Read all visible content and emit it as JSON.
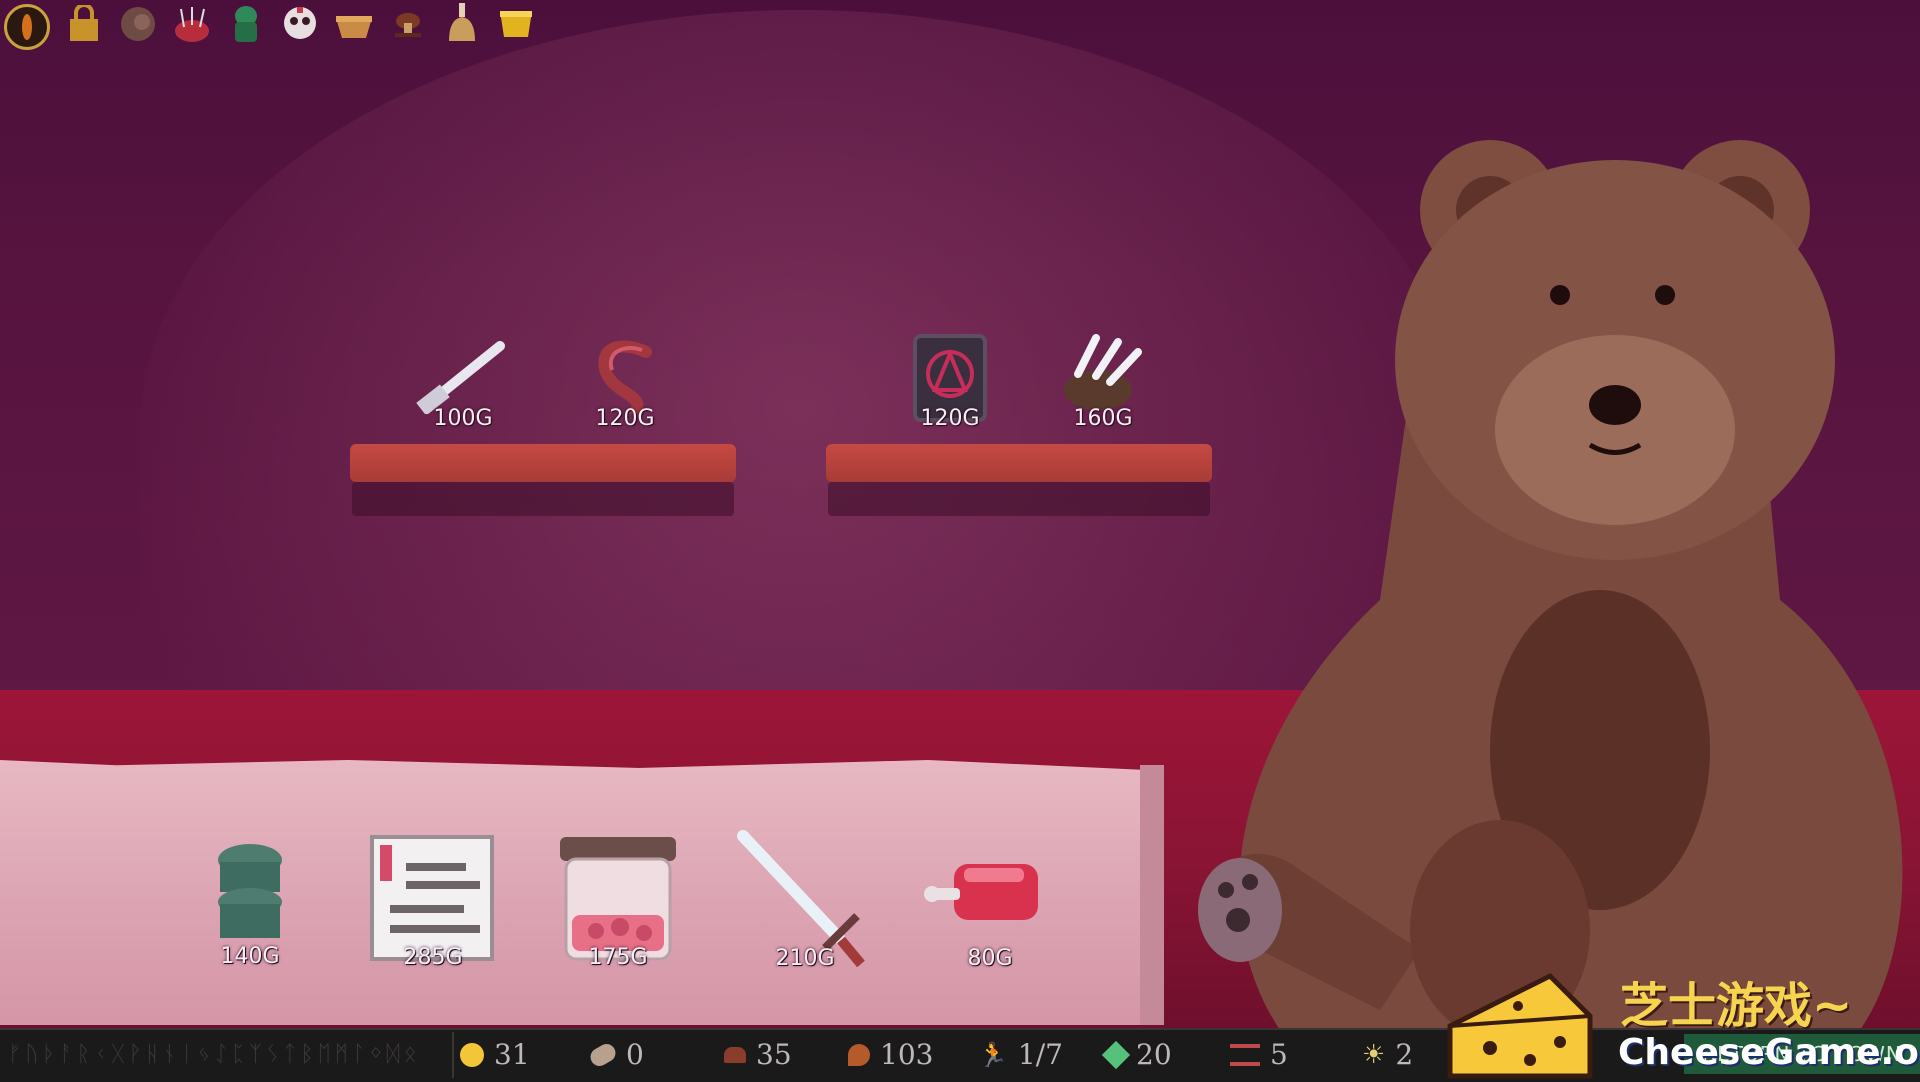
{
  "shop": {
    "shelf_items": [
      {
        "name": "hammer",
        "price": "100G"
      },
      {
        "name": "hook",
        "price": "120G"
      },
      {
        "name": "rune-tablet",
        "price": "120G"
      },
      {
        "name": "claw",
        "price": "160G"
      }
    ],
    "counter_items": [
      {
        "name": "stacked-stones",
        "price": "140G"
      },
      {
        "name": "scroll",
        "price": "285G"
      },
      {
        "name": "jar-of-meat",
        "price": "175G"
      },
      {
        "name": "sword",
        "price": "210G"
      },
      {
        "name": "raw-meat",
        "price": "80G"
      }
    ]
  },
  "top_bar": {
    "relics": [
      "eye-icon",
      "lock-icon",
      "stone-icon",
      "pincushion-icon",
      "cthulhu-idol-icon",
      "mask-icon",
      "basket-icon",
      "mushroom-icon",
      "bell-icon",
      "cup-icon"
    ]
  },
  "bottom_bar": {
    "runes": "ᚠᚢᚦᚨᚱᚲᚷᚹᚺᚾᛁᛃᛇᛈᛉᛊᛏᛒᛖᛗᛚᛜᛞᛟ",
    "stats": [
      {
        "icon": "gold-coin-icon",
        "value": "31",
        "color": "#f3c63a"
      },
      {
        "icon": "bread-icon",
        "value": "0",
        "color": "#b8a08f"
      },
      {
        "icon": "hat-icon",
        "value": "35",
        "color": "#8a3d2b"
      },
      {
        "icon": "meat-leg-icon",
        "value": "103",
        "color": "#b55a2a"
      },
      {
        "icon": "runner-icon",
        "value": "1/7",
        "color": "#7bb06a"
      },
      {
        "icon": "crystal-icon",
        "value": "20",
        "color": "#55c17a"
      },
      {
        "icon": "bars-icon",
        "value": "5",
        "color": "#c04a4a"
      },
      {
        "icon": "sun-icon",
        "value": "2",
        "color": "#e3cf77"
      }
    ],
    "return_button": "RETURN TO TOWN"
  },
  "watermark": {
    "line1": "芝士游戏~",
    "line2": "CheeseGame.org"
  }
}
